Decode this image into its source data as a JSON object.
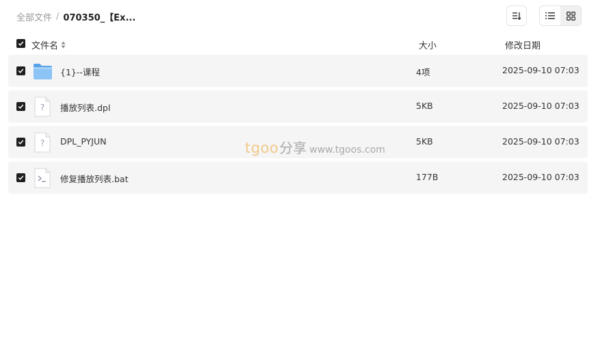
{
  "breadcrumb": {
    "root": "全部文件",
    "separator": "/",
    "current": "070350_【Ex..."
  },
  "toolbar": {
    "sort_icon": "sort-icon",
    "list_view_icon": "list-view-icon",
    "grid_view_icon": "grid-view-icon",
    "active_view": "grid"
  },
  "header": {
    "name": "文件名",
    "size": "大小",
    "date": "修改日期"
  },
  "files": [
    {
      "name": "{1}--课程",
      "size": "4项",
      "date": "2025-09-10 07:03",
      "icon": "folder-icon",
      "checked": true
    },
    {
      "name": "播放列表.dpl",
      "size": "5KB",
      "date": "2025-09-10 07:03",
      "icon": "unknown-file-icon",
      "checked": true
    },
    {
      "name": "DPL_PYJUN",
      "size": "5KB",
      "date": "2025-09-10 07:03",
      "icon": "unknown-file-icon",
      "checked": true
    },
    {
      "name": "修复播放列表.bat",
      "size": "177B",
      "date": "2025-09-10 07:03",
      "icon": "script-file-icon",
      "checked": true
    }
  ],
  "watermark": {
    "brand": "tgoo",
    "cn": "分享",
    "url": "www.tgoos.com"
  },
  "colors": {
    "row_bg": "#f5f5f5",
    "checkbox": "#1f1f1f",
    "folder": "#6fb2f0",
    "watermark_brand": "#f1c98a"
  }
}
